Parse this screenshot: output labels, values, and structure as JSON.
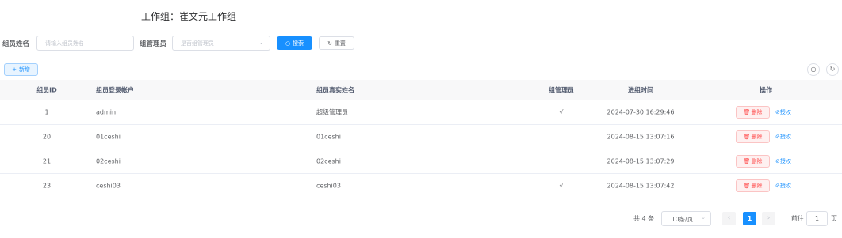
{
  "header": {
    "title": "工作组：崔文元工作组"
  },
  "filters": {
    "name_label": "组员姓名",
    "name_placeholder": "请输入组员姓名",
    "manager_label": "组管理员",
    "manager_placeholder": "是否组管理员",
    "search_label": "搜索",
    "reset_label": "重置"
  },
  "toolbar": {
    "add_label": "新增"
  },
  "table": {
    "columns": [
      "组员ID",
      "组员登录帐户",
      "组员真实姓名",
      "组管理员",
      "进组时间",
      "操作"
    ],
    "rows": [
      {
        "id": "1",
        "account": "admin",
        "name": "超级管理员",
        "manager": "√",
        "time": "2024-07-30 16:29:46",
        "delete": "删除",
        "auth": "授权"
      },
      {
        "id": "20",
        "account": "01ceshi",
        "name": "01ceshi",
        "manager": "",
        "time": "2024-08-15 13:07:16",
        "delete": "删除",
        "auth": "授权"
      },
      {
        "id": "21",
        "account": "02ceshi",
        "name": "02ceshi",
        "manager": "",
        "time": "2024-08-15 13:07:29",
        "delete": "删除",
        "auth": "授权"
      },
      {
        "id": "23",
        "account": "ceshi03",
        "name": "ceshi03",
        "manager": "√",
        "time": "2024-08-15 13:07:42",
        "delete": "删除",
        "auth": "授权"
      }
    ]
  },
  "pagination": {
    "total": "共 4 条",
    "page_size": "10条/页",
    "current_page": "1",
    "goto_prefix": "前往",
    "goto_value": "1",
    "goto_suffix": "页"
  },
  "colors": {
    "primary": "#1890ff",
    "danger": "#ff4949"
  }
}
